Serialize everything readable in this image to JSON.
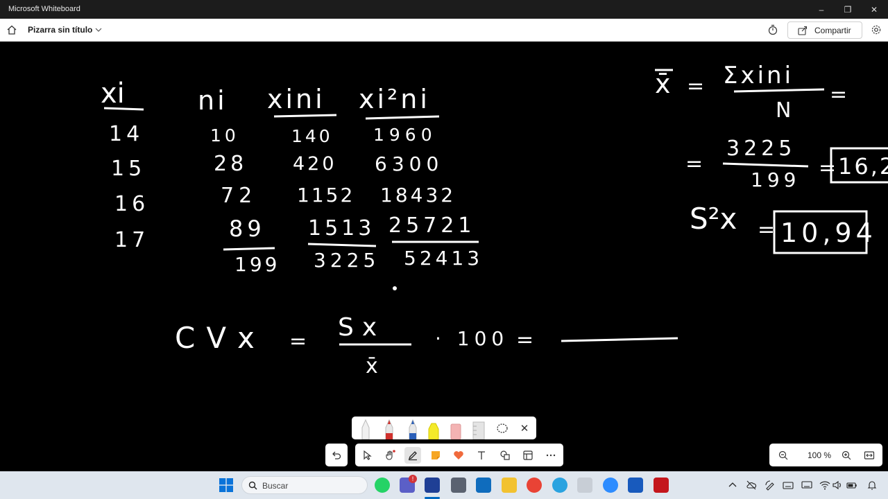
{
  "window": {
    "title": "Microsoft Whiteboard",
    "controls": [
      "–",
      "❐",
      "✕"
    ]
  },
  "header": {
    "board_title": "Pizarra sin título",
    "share_label": "Compartir"
  },
  "board": {
    "col_headers": [
      "xi",
      "ni",
      "xini",
      "xi²ni"
    ],
    "rows": [
      [
        "14",
        "10",
        "140",
        "1960"
      ],
      [
        "15",
        "28",
        "420",
        "6300"
      ],
      [
        "16",
        "72",
        "1152",
        "18432"
      ],
      [
        "17",
        "89",
        "1513",
        "25721"
      ]
    ],
    "totals": [
      "199",
      "3225",
      "52413"
    ],
    "mean_formula": {
      "lhs": "x̄",
      "eq": "=",
      "numerator": "Σxini",
      "denominator": "N",
      "trail_eq": "="
    },
    "mean_calc": {
      "eq": "=",
      "numerator": "3225",
      "denominator": "199",
      "result": "16,2"
    },
    "variance": {
      "lhs": "S²x",
      "eq": "=",
      "result": "10,94"
    },
    "cv_formula": {
      "lhs": "CVx",
      "eq": "=",
      "numerator": "Sx",
      "denominator": "x̄",
      "factor": "· 100",
      "eq2": "="
    }
  },
  "zoom": {
    "level": "100 %"
  },
  "taskbar": {
    "search_label": "Buscar",
    "notification_badge": "!"
  },
  "colors": {
    "canvas": "#000000",
    "ink": "#ffffff",
    "titlebar": "#1c1c1c",
    "taskbar": "#dfe6ee",
    "accent": "#0067c0"
  },
  "icons": [
    "home-icon",
    "chevron-down-icon",
    "timer-icon",
    "share-icon",
    "gear-icon",
    "undo-icon",
    "select-icon",
    "hand-icon",
    "pen-icon",
    "note-icon",
    "heart-icon",
    "text-icon",
    "shapes-icon",
    "template-icon",
    "more-icon",
    "zoom-out-icon",
    "zoom-in-icon",
    "fit-icon"
  ]
}
